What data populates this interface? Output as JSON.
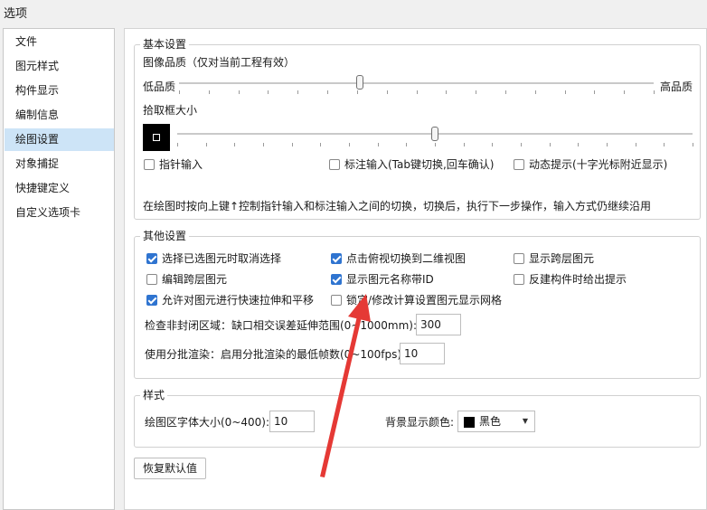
{
  "window": {
    "title": "选项"
  },
  "nav": {
    "items": [
      {
        "label": "文件"
      },
      {
        "label": "图元样式"
      },
      {
        "label": "构件显示"
      },
      {
        "label": "编制信息"
      },
      {
        "label": "绘图设置",
        "selected": true
      },
      {
        "label": "对象捕捉"
      },
      {
        "label": "快捷键定义"
      },
      {
        "label": "自定义选项卡"
      }
    ]
  },
  "basic": {
    "legend": "基本设置",
    "image_quality": {
      "label": "图像品质（仅对当前工程有效）",
      "low": "低品质",
      "high": "高品质",
      "level": 0.38
    },
    "pick_box": {
      "label": "拾取框大小",
      "level": 0.5
    },
    "checkboxes": [
      {
        "label": "指针输入",
        "checked": false
      },
      {
        "label": "标注输入(Tab键切换,回车确认)",
        "checked": false
      },
      {
        "label": "动态提示(十字光标附近显示)",
        "checked": false
      }
    ],
    "hint": "在绘图时按向上键↑控制指针输入和标注输入之间的切换，切换后，执行下一步操作，输入方式仍继续沿用"
  },
  "other": {
    "legend": "其他设置",
    "checkboxes": [
      {
        "label": "选择已选图元时取消选择",
        "checked": true
      },
      {
        "label": "点击俯视切换到二维视图",
        "checked": true
      },
      {
        "label": "显示跨层图元",
        "checked": false
      },
      {
        "label": "编辑跨层图元",
        "checked": false
      },
      {
        "label": "显示图元名称带ID",
        "checked": true
      },
      {
        "label": "反建构件时给出提示",
        "checked": false
      },
      {
        "label": "允许对图元进行快速拉伸和平移",
        "checked": true
      },
      {
        "label": "锁定/修改计算设置图元显示网格",
        "checked": false
      }
    ],
    "gap_check": {
      "label": "检查非封闭区域：缺口相交误差延伸范围(0~1000mm):",
      "value": "300"
    },
    "batch_render": {
      "label": "使用分批渲染：启用分批渲染的最低帧数(0~100fps):",
      "value": "10"
    }
  },
  "style": {
    "legend": "样式",
    "font_size": {
      "label": "绘图区字体大小(0~400):",
      "value": "10"
    },
    "bg_color": {
      "label": "背景显示颜色:",
      "value": "黑色",
      "color": "#000000"
    }
  },
  "reset_button": {
    "label": "恢复默认值"
  },
  "colors": {
    "accent": "#2f74d0",
    "selected_nav": "#cde4f7",
    "annotation_arrow": "#e53935"
  }
}
